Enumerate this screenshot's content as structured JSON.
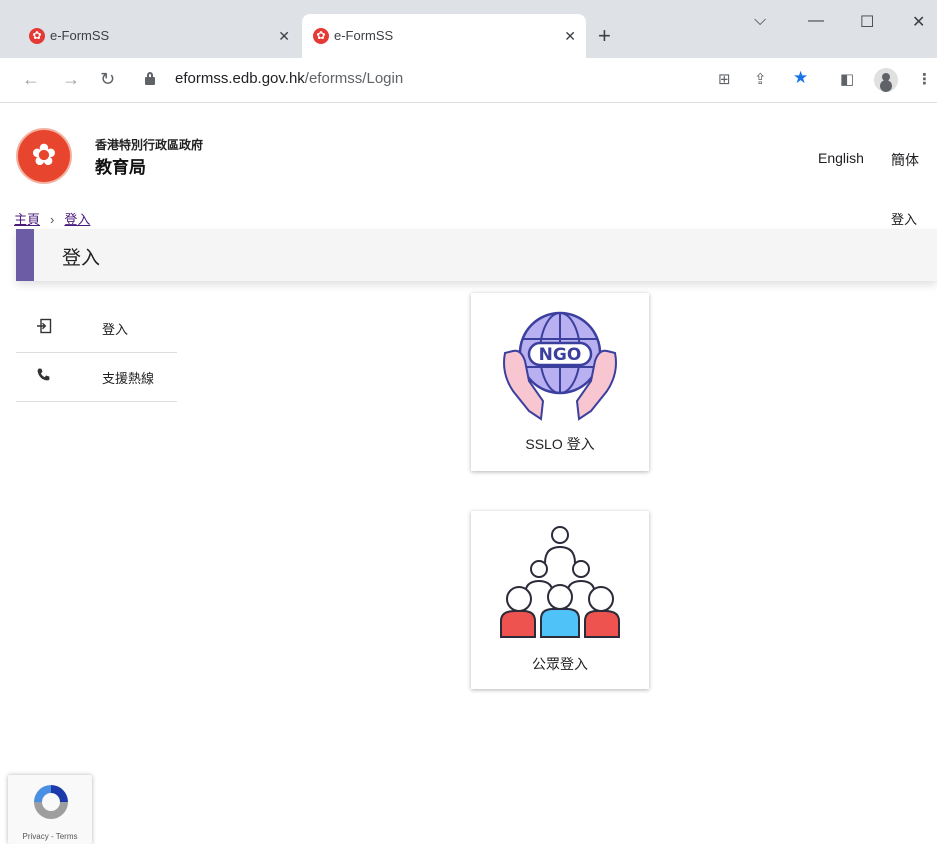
{
  "browser": {
    "tabs": [
      {
        "title": "e-FormSS",
        "active": false
      },
      {
        "title": "e-FormSS",
        "active": true
      }
    ],
    "url_host": "eformss.edb.gov.hk",
    "url_path": "/eformss/Login"
  },
  "header": {
    "gov_name": "香港特別行政區政府",
    "dept_name": "教育局",
    "lang_english": "English",
    "lang_simplified": "簡体"
  },
  "breadcrumb": {
    "home": "主頁",
    "separator": "›",
    "current": "登入"
  },
  "login_link": "登入",
  "page_title": "登入",
  "sidenav": {
    "items": [
      {
        "label": "登入",
        "icon": "login-icon"
      },
      {
        "label": "支援熱線",
        "icon": "phone-icon"
      }
    ]
  },
  "cards": [
    {
      "label": "SSLO 登入",
      "badge": "NGO"
    },
    {
      "label": "公眾登入"
    }
  ],
  "recaptcha": {
    "terms": "Privacy - Terms"
  },
  "colors": {
    "accent": "#6b5ca5",
    "link": "#4b1a7a",
    "logo_red": "#e8452f"
  }
}
